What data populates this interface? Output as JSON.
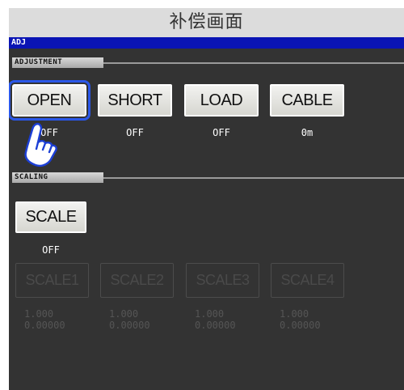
{
  "caption": "补偿画面",
  "screen_title": "ADJ",
  "adjustment": {
    "label": "ADJUSTMENT",
    "buttons": [
      {
        "label": "OPEN",
        "value": "OFF",
        "selected": true
      },
      {
        "label": "SHORT",
        "value": "OFF"
      },
      {
        "label": "LOAD",
        "value": "OFF"
      },
      {
        "label": "CABLE",
        "value": "0m"
      }
    ]
  },
  "scaling": {
    "label": "SCALING",
    "scale_button": {
      "label": "SCALE",
      "value": "OFF"
    },
    "slots": [
      {
        "label": "SCALE1",
        "a": "1.000",
        "b": "0.00000"
      },
      {
        "label": "SCALE2",
        "a": "1.000",
        "b": "0.00000"
      },
      {
        "label": "SCALE3",
        "a": "1.000",
        "b": "0.00000"
      },
      {
        "label": "SCALE4",
        "a": "1.000",
        "b": "0.00000"
      }
    ]
  },
  "icons": {
    "pointer": "hand-pointer-icon"
  },
  "colors": {
    "title_bar": "#0a14b4",
    "screen_bg": "#333333",
    "selection_outline": "#2a57e8",
    "caption_bg": "#dcdcdc"
  }
}
